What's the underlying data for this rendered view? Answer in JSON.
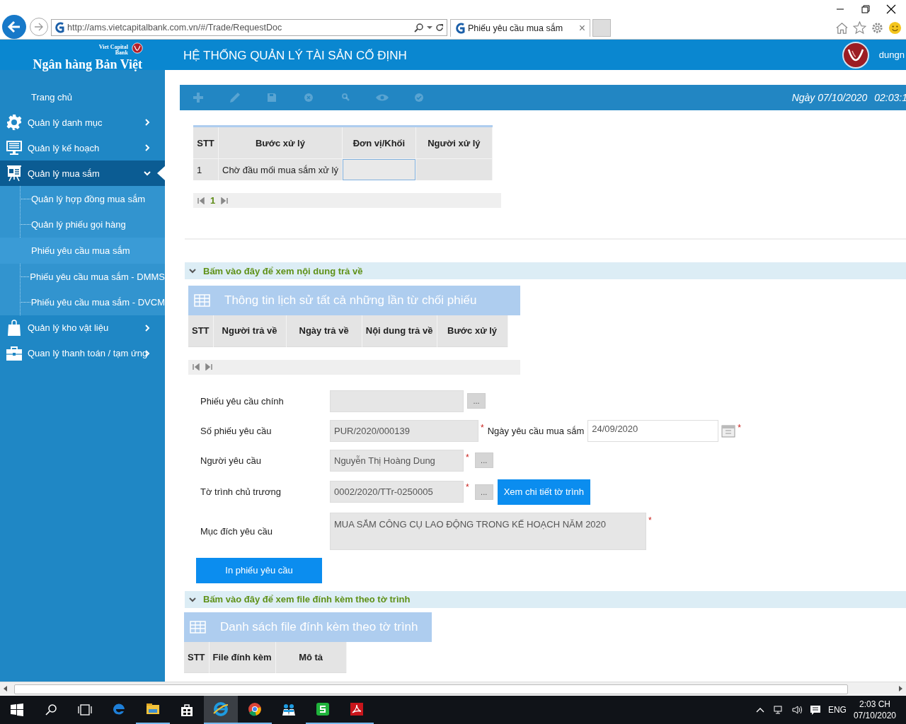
{
  "browser": {
    "address": "http://ams.vietcapitalbank.com.vn/#/Trade/RequestDoc",
    "tab_title": "Phiếu yêu cầu mua sắm",
    "tab_close": "×"
  },
  "header": {
    "logo_small": "Viet Capital Bank",
    "logo_name": "Ngân hàng Bản Việt",
    "title": "HỆ THỐNG QUẢN LÝ TÀI SẢN CỐ ĐỊNH",
    "user": "dungn"
  },
  "sidebar": {
    "items": [
      {
        "kind": "link",
        "label": "Trang chủ",
        "selected": false
      },
      {
        "kind": "gear",
        "label": "Quản lý danh mục",
        "selected": false,
        "expanded": false
      },
      {
        "kind": "monitor",
        "label": "Quản lý kế hoạch",
        "selected": false,
        "expanded": false
      },
      {
        "kind": "easel",
        "label": "Quản lý mua sắm",
        "selected": true,
        "expanded": true,
        "children": [
          {
            "label": "Quản lý hợp đồng mua sắm",
            "selected": false
          },
          {
            "label": "Quản lý phiếu gọi hàng",
            "selected": false
          },
          {
            "label": "Phiếu yêu cầu mua sắm",
            "selected": true
          },
          {
            "label": "Phiếu yêu cầu mua sắm - DMMS",
            "selected": false
          },
          {
            "label": "Phiếu yêu cầu mua sắm - DVCM",
            "selected": false
          }
        ]
      },
      {
        "kind": "bag",
        "label": "Quản lý kho vật liệu",
        "selected": false,
        "expanded": false
      },
      {
        "kind": "briefcase",
        "label": "Quan lý thanh toán / tạm ứng",
        "selected": false,
        "expanded": false
      }
    ]
  },
  "toolbar": {
    "buttons": [
      {
        "kind": "add",
        "disabled": true
      },
      {
        "kind": "edit",
        "disabled": true
      },
      {
        "kind": "save",
        "disabled": true
      },
      {
        "kind": "cancel",
        "disabled": true
      },
      {
        "kind": "search",
        "disabled": true
      },
      {
        "kind": "view",
        "disabled": true
      },
      {
        "kind": "approve",
        "disabled": true
      }
    ],
    "date": "Ngày 07/10/2020",
    "time": "02:03:1"
  },
  "process_table": {
    "columns": [
      "STT",
      "Bước xử lý",
      "Đơn vị/Khối",
      "Người xử lý"
    ],
    "rows": [
      {
        "stt": "1",
        "step": "Chờ đầu mối mua sắm xử lý"
      }
    ],
    "pager": {
      "page": "1"
    }
  },
  "returns_section": {
    "title": "Bấm vào đây để xem nội dung trả về",
    "expanded": true,
    "panel_title": "Thông tin lịch sử tất cả những lần từ chối phiếu",
    "columns": [
      "STT",
      "Người trả về",
      "Ngày trả về",
      "Nội dung trả về",
      "Bước xử lý"
    ]
  },
  "form": {
    "fields": [
      {
        "kind": "lookup",
        "label": "Phiếu yêu cầu chính",
        "disabled": true,
        "picker": "..."
      },
      {
        "kind": "text",
        "label": "Số phiếu yêu cầu",
        "value": "PUR/2020/000139",
        "disabled": true,
        "required_mark": "*",
        "side": {
          "label": "Ngày yêu cầu mua sắm",
          "value": "24/09/2020",
          "disabled": false,
          "required_mark": "*"
        }
      },
      {
        "kind": "lookup",
        "label": "Người yêu cầu",
        "value": "Nguyễn Thị Hoàng Dung",
        "disabled": true,
        "required_mark": "*",
        "picker": "..."
      },
      {
        "kind": "lookup",
        "label": "Tờ trình chủ trương",
        "value": "0002/2020/TTr-0250005",
        "disabled": true,
        "required_mark": "*",
        "picker": "...",
        "action": "Xem chi tiết tờ trình"
      },
      {
        "kind": "textarea",
        "label": "Mục đích yêu cầu",
        "value": "MUA SẮM CÔNG CỤ LAO ĐỘNG TRONG KẾ HOẠCH NĂM 2020",
        "disabled": true,
        "required_mark": "*"
      }
    ],
    "print_button": "In phiếu yêu cầu"
  },
  "attachments_section": {
    "title": "Bấm vào đây để xem file đính kèm theo tờ trình",
    "expanded": true,
    "panel_title": "Danh sách file đính kèm theo tờ trình",
    "columns": [
      "STT",
      "File đính kèm",
      "Mô tả"
    ]
  },
  "taskbar": {
    "apps": [
      {
        "kind": "edge",
        "running": false,
        "selected": false
      },
      {
        "kind": "explorer",
        "running": true,
        "selected": false
      },
      {
        "kind": "store",
        "running": false,
        "selected": false
      },
      {
        "kind": "ie",
        "running": true,
        "selected": true
      },
      {
        "kind": "chrome",
        "running": true,
        "selected": false
      },
      {
        "kind": "people",
        "running": false,
        "selected": false
      },
      {
        "kind": "sheet",
        "running": true,
        "selected": false
      },
      {
        "kind": "pdf",
        "running": true,
        "selected": false
      }
    ],
    "language": "ENG",
    "time": "2:03 CH",
    "date": "07/10/2020"
  }
}
